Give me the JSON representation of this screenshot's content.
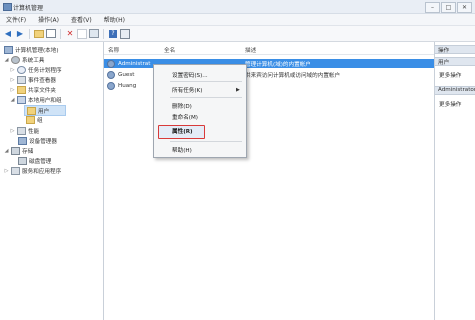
{
  "window": {
    "title": "计算机管理"
  },
  "window_controls": {
    "minimize": "–",
    "maximize": "□",
    "close": "✕"
  },
  "menubar": {
    "items": [
      "文件(F)",
      "操作(A)",
      "查看(V)",
      "帮助(H)"
    ]
  },
  "toolbar": {
    "icons": [
      "back-arrow-icon",
      "forward-arrow-icon",
      "folder-up-icon",
      "show-hide-tree-icon",
      "delete-icon",
      "properties-icon",
      "export-icon",
      "help-icon",
      "console-icon"
    ]
  },
  "tree": {
    "root": "计算机管理(本地)",
    "system_tools": "系统工具",
    "task_scheduler": "任务计划程序",
    "event_viewer": "事件查看器",
    "shared_folders": "共享文件夹",
    "local_users": "本地用户和组",
    "users": "用户",
    "groups": "组",
    "performance": "性能",
    "device_manager": "设备管理器",
    "storage": "存储",
    "disk_management": "磁盘管理",
    "services": "服务和应用程序"
  },
  "list": {
    "columns": [
      "名称",
      "全名",
      "描述"
    ],
    "rows": [
      {
        "name": "Administrat",
        "fullname": "",
        "desc": "管理计算机(域)的内置帐户",
        "selected": true
      },
      {
        "name": "Guest",
        "fullname": "",
        "desc": "供来宾访问计算机或访问域的内置帐户",
        "selected": false
      },
      {
        "name": "Huang",
        "fullname": "",
        "desc": "",
        "selected": false
      }
    ]
  },
  "context_menu": {
    "set_password": "设置密码(S)...",
    "all_tasks": "所有任务(K)",
    "delete": "删除(D)",
    "rename": "重命名(M)",
    "properties": "属性(R)",
    "help": "帮助(H)",
    "highlight_color": "#d83a3a"
  },
  "actions": {
    "header1": "操作",
    "header2": "用户",
    "more1": "更多操作",
    "header3": "Administrator",
    "more2": "更多操作"
  },
  "colors": {
    "selection": "#3a8ee6",
    "tree_selection": "#cfe3f7"
  }
}
